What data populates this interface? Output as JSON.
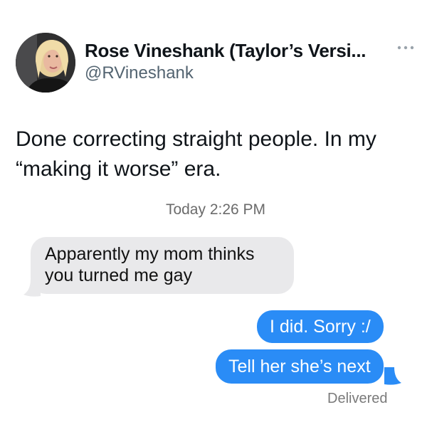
{
  "tweet": {
    "author": {
      "display_name": "Rose Vineshank (Taylor’s Versi...",
      "handle": "@RVineshank",
      "more_icon": "ellipsis-icon"
    },
    "text": "Done correcting straight people. In my\n“making it worse” era."
  },
  "messages": {
    "timestamp": "Today 2:26 PM",
    "received": [
      {
        "text": "Apparently my mom thinks\nyou turned me gay"
      }
    ],
    "sent": [
      {
        "text": "I did. Sorry :/"
      },
      {
        "text": "Tell her she’s next"
      }
    ],
    "status": "Delivered"
  },
  "colors": {
    "sent_bubble": "#2a8cf6",
    "received_bubble": "#e9e9eb",
    "handle_gray": "#536471"
  }
}
